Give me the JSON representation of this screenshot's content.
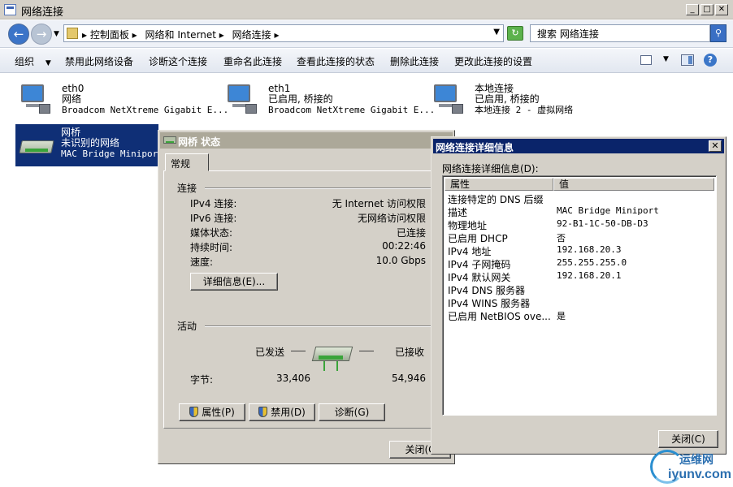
{
  "window": {
    "title": "网络连接",
    "minimize_glyph": "_",
    "maximize_glyph": "□",
    "close_glyph": "✕"
  },
  "address": {
    "breadcrumb": [
      "▸ 控制面板 ▸",
      "网络和 Internet ▸",
      "网络连接 ▸"
    ],
    "search_placeholder": "搜索 网络连接"
  },
  "toolbar": {
    "organize": "组织",
    "disable_device": "禁用此网络设备",
    "diagnose": "诊断这个连接",
    "rename": "重命名此连接",
    "view_status": "查看此连接的状态",
    "delete": "删除此连接",
    "change_settings": "更改此连接的设置"
  },
  "connections": [
    {
      "name": "eth0",
      "status": "网络",
      "device": "Broadcom NetXtreme Gigabit E..."
    },
    {
      "name": "eth1",
      "status": "已启用, 桥接的",
      "device": "Broadcom NetXtreme Gigabit E..."
    },
    {
      "name": "本地连接",
      "status": "已启用, 桥接的",
      "device": "本地连接 2 - 虚拟网络"
    },
    {
      "name": "网桥",
      "status": "未识别的网络",
      "device": "MAC Bridge Miniport"
    }
  ],
  "status_dialog": {
    "title": "网桥 状态",
    "tab": "常规",
    "connection_section": "连接",
    "rows": [
      {
        "label": "IPv4 连接:",
        "value": "无 Internet 访问权限"
      },
      {
        "label": "IPv6 连接:",
        "value": "无网络访问权限"
      },
      {
        "label": "媒体状态:",
        "value": "已连接"
      },
      {
        "label": "持续时间:",
        "value": "00:22:46"
      },
      {
        "label": "速度:",
        "value": "10.0 Gbps"
      }
    ],
    "details_button": "详细信息(E)...",
    "activity_section": "活动",
    "sent_label": "已发送",
    "received_label": "已接收",
    "bytes_label": "字节:",
    "bytes_sent": "33,406",
    "bytes_received": "54,946",
    "properties_button": "属性(P)",
    "disable_button": "禁用(D)",
    "diagnose_button": "诊断(G)",
    "close_button": "关闭(C"
  },
  "details_dialog": {
    "title": "网络连接详细信息",
    "caption": "网络连接详细信息(D):",
    "col_property": "属性",
    "col_value": "值",
    "rows": [
      {
        "property": "连接特定的 DNS 后缀",
        "value": ""
      },
      {
        "property": "描述",
        "value": "MAC Bridge Miniport"
      },
      {
        "property": "物理地址",
        "value": "92-B1-1C-50-DB-D3"
      },
      {
        "property": "已启用 DHCP",
        "value": "否"
      },
      {
        "property": "IPv4 地址",
        "value": "192.168.20.3"
      },
      {
        "property": "IPv4 子网掩码",
        "value": "255.255.255.0"
      },
      {
        "property": "IPv4 默认网关",
        "value": "192.168.20.1"
      },
      {
        "property": "IPv4 DNS 服务器",
        "value": ""
      },
      {
        "property": "IPv4 WINS 服务器",
        "value": ""
      },
      {
        "property": "已启用 NetBIOS ove...",
        "value": "是"
      }
    ],
    "close_button": "关闭(C)",
    "close_glyph": "✕"
  },
  "watermark": {
    "cn": "运维网",
    "url": "iyunv.com"
  }
}
